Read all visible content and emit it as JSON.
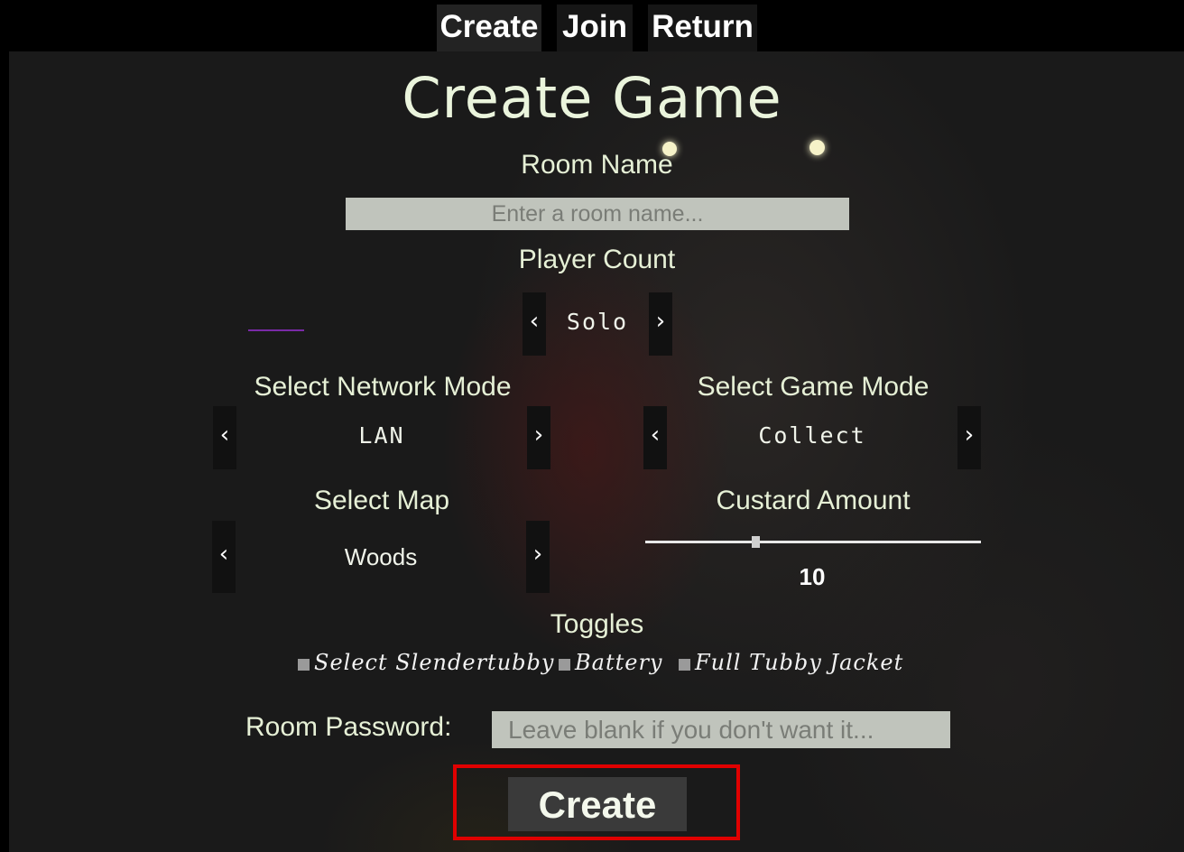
{
  "tabs": {
    "create": "Create",
    "join": "Join",
    "return": "Return"
  },
  "title": "Create Game",
  "room_name": {
    "label": "Room Name",
    "placeholder": "Enter a room name..."
  },
  "player_count": {
    "label": "Player Count",
    "value": "Solo",
    "prev": "‹",
    "next": "›"
  },
  "network_mode": {
    "label": "Select Network Mode",
    "value": "LAN",
    "prev": "‹",
    "next": "›"
  },
  "game_mode": {
    "label": "Select Game Mode",
    "value": "Collect",
    "prev": "‹",
    "next": "›"
  },
  "map": {
    "label": "Select Map",
    "value": "Woods",
    "prev": "‹",
    "next": "›"
  },
  "custard": {
    "label": "Custard Amount",
    "value": "10",
    "slider_fraction": 0.33
  },
  "toggles": {
    "label": "Toggles",
    "items": [
      "Select Slendertubby",
      "Battery",
      "Full Tubby Jacket"
    ]
  },
  "password": {
    "label": "Room Password:",
    "placeholder": "Leave blank if you don't want it..."
  },
  "create_button": "Create",
  "colors": {
    "highlight": "#e00000",
    "heading": "#e6f0d6",
    "input_bg": "#c0c4bc"
  }
}
